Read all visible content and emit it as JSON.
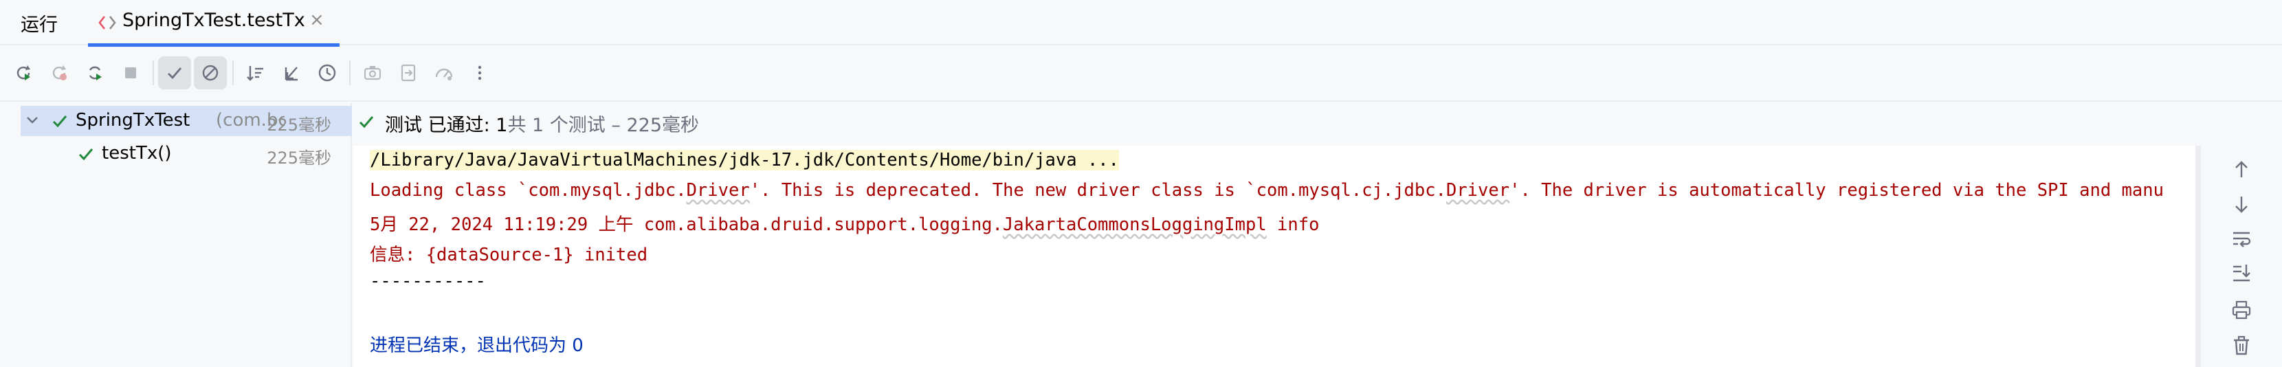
{
  "window": {
    "tool_title": "运行",
    "active_tab": {
      "label": "SpringTxTest.testTx",
      "close": "×"
    }
  },
  "toolbar": {
    "buttons": [
      {
        "name": "rerun-icon"
      },
      {
        "name": "rerun-failed-icon"
      },
      {
        "name": "toggle-auto-test-icon"
      },
      {
        "name": "stop-icon"
      },
      {
        "name": "show-passed-icon",
        "active": true
      },
      {
        "name": "show-ignored-icon",
        "active": true
      },
      {
        "name": "sort-alphabetically-icon"
      },
      {
        "name": "collapse-all-icon"
      },
      {
        "name": "sort-by-duration-icon"
      },
      {
        "name": "screenshot-icon"
      },
      {
        "name": "export-icon"
      },
      {
        "name": "coverage-icon"
      },
      {
        "name": "more-icon"
      }
    ]
  },
  "tree": {
    "root": {
      "name": "SpringTxTest",
      "package": "(com.bc",
      "time": "225毫秒",
      "status": "passed"
    },
    "children": [
      {
        "name": "testTx()",
        "time": "225毫秒",
        "status": "passed"
      }
    ]
  },
  "status_bar": {
    "prefix": "测试 已通过: ",
    "passed": "1",
    "summary": "共 1 个测试 – 225毫秒"
  },
  "console": {
    "lines": [
      {
        "type": "cmd",
        "text": "/Library/Java/JavaVirtualMachines/jdk-17.jdk/Contents/Home/bin/java ..."
      },
      {
        "type": "err",
        "parts": [
          "Loading class `com.mysql.jdbc.",
          "Driver",
          "'. This is deprecated. The new driver class is `com.mysql.cj.jdbc.",
          "Driver",
          "'. The driver is automatically registered via the SPI and manu"
        ]
      },
      {
        "type": "err",
        "parts": [
          "5月 22, 2024 11:19:29 上午 com.alibaba.druid.support.logging.",
          "JakartaCommonsLoggingImpl",
          " info"
        ]
      },
      {
        "type": "err",
        "text": "信息: {dataSource-1} inited"
      },
      {
        "type": "out",
        "text": "-----------"
      },
      {
        "type": "exit",
        "text": "进程已结束，退出代码为 0"
      }
    ]
  },
  "gutter": {
    "buttons": [
      "up-arrow-icon",
      "down-arrow-icon",
      "soft-wrap-icon",
      "scroll-to-end-icon",
      "print-icon",
      "clear-all-icon"
    ]
  },
  "colors": {
    "accent": "#3574f0",
    "pass_green": "#208a3c",
    "error_text": "#a60000",
    "exit_text": "#0033b3",
    "selection": "#d5e1f6"
  }
}
